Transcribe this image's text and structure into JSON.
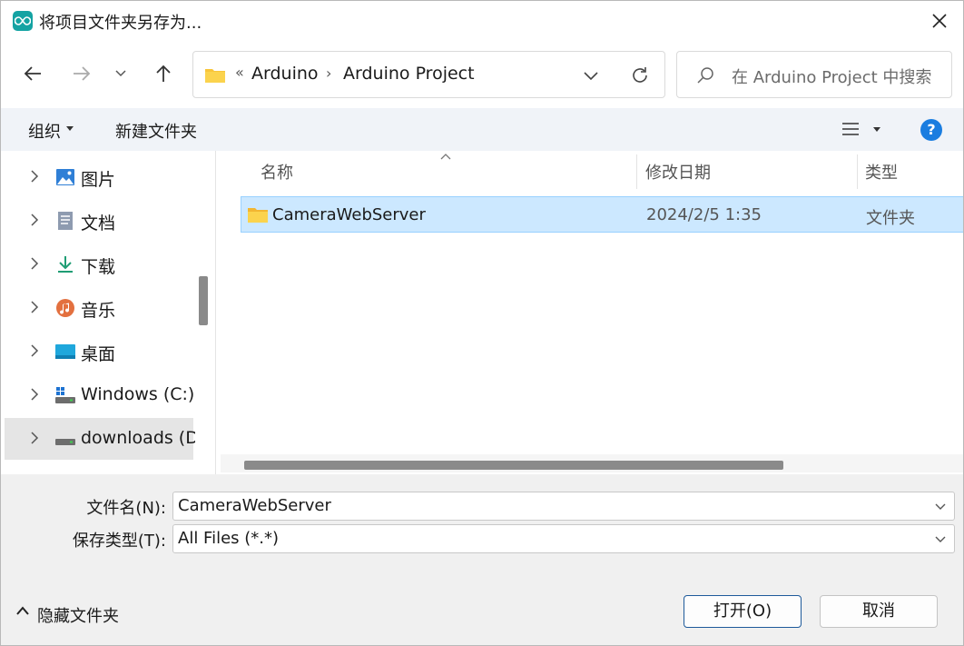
{
  "window": {
    "title": "将项目文件夹另存为..."
  },
  "address": {
    "breadcrumb_prefix": "«",
    "crumbs": [
      "Arduino",
      "Arduino Project"
    ],
    "separator": "›"
  },
  "search": {
    "placeholder": "在 Arduino Project 中搜索"
  },
  "toolbar": {
    "organize_label": "组织",
    "new_folder_label": "新建文件夹",
    "help_label": "?"
  },
  "nav_pane": {
    "items": [
      {
        "label": "图片",
        "icon": "pictures-icon"
      },
      {
        "label": "文档",
        "icon": "documents-icon"
      },
      {
        "label": "下载",
        "icon": "downloads-icon"
      },
      {
        "label": "音乐",
        "icon": "music-icon"
      },
      {
        "label": "桌面",
        "icon": "desktop-icon"
      },
      {
        "label": "Windows (C:)",
        "icon": "drive-c-icon"
      },
      {
        "label": "downloads (D:",
        "icon": "drive-d-icon",
        "selected": true
      }
    ]
  },
  "file_list": {
    "columns": {
      "name": "名称",
      "date": "修改日期",
      "type": "类型"
    },
    "rows": [
      {
        "name": "CameraWebServer",
        "date": "2024/2/5 1:35",
        "type": "文件夹",
        "selected": true
      }
    ]
  },
  "form": {
    "filename_label": "文件名(N):",
    "filename_value": "CameraWebServer",
    "filetype_label": "保存类型(T):",
    "filetype_value": "All Files (*.*)"
  },
  "footer": {
    "hide_folders_label": "隐藏文件夹",
    "open_label": "打开(O)",
    "cancel_label": "取消"
  },
  "colors": {
    "accent": "#1a7de0",
    "selection": "#cce8ff",
    "folder": "#f8c53a",
    "app_icon": "#14a3a3"
  }
}
